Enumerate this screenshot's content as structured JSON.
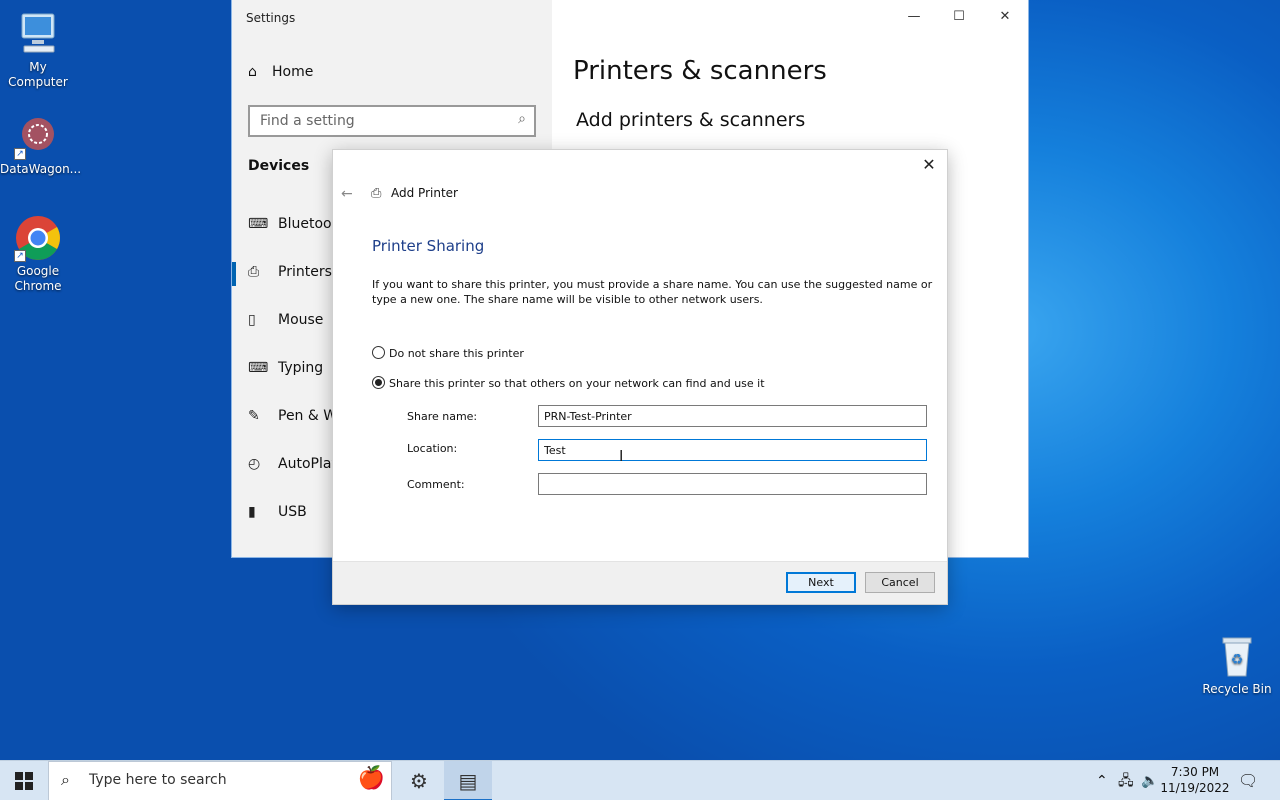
{
  "desktop": {
    "icons": [
      {
        "label": "My Computer",
        "icon": "computer-icon"
      },
      {
        "label": "DataWagon...",
        "icon": "datawagon-icon"
      },
      {
        "label": "Google Chrome",
        "icon": "chrome-icon"
      },
      {
        "label": "Recycle Bin",
        "icon": "recycle-bin-icon"
      }
    ]
  },
  "settings": {
    "title": "Settings",
    "controls": {
      "minimize": "—",
      "maximize": "☐",
      "close": "✕"
    },
    "home": "Home",
    "search_placeholder": "Find a setting",
    "group": "Devices",
    "nav": [
      {
        "label": "Bluetooth",
        "icon": "bluetooth-keyboard-icon"
      },
      {
        "label": "Printers &",
        "icon": "printer-icon",
        "selected": true
      },
      {
        "label": "Mouse",
        "icon": "mouse-icon"
      },
      {
        "label": "Typing",
        "icon": "keyboard-icon"
      },
      {
        "label": "Pen & W",
        "icon": "pen-icon"
      },
      {
        "label": "AutoPlay",
        "icon": "autoplay-icon"
      },
      {
        "label": "USB",
        "icon": "usb-icon"
      }
    ],
    "page_title": "Printers & scanners",
    "section_title": "Add printers & scanners"
  },
  "dialog": {
    "title": "Add Printer",
    "heading": "Printer Sharing",
    "description": "If you want to share this printer, you must provide a share name. You can use the suggested name or type a new one. The share name will be visible to other network users.",
    "options": [
      {
        "label": "Do not share this printer",
        "selected": false
      },
      {
        "label": "Share this printer so that others on your network can find and use it",
        "selected": true
      }
    ],
    "fields": {
      "share_name": {
        "label": "Share name:",
        "value": "PRN-Test-Printer"
      },
      "location": {
        "label": "Location:",
        "value": "Test"
      },
      "comment": {
        "label": "Comment:",
        "value": ""
      }
    },
    "buttons": {
      "next": "Next",
      "cancel": "Cancel"
    }
  },
  "taskbar": {
    "search_placeholder": "Type here to search",
    "time": "7:30 PM",
    "date": "11/19/2022"
  },
  "colors": {
    "accent": "#0078d7",
    "heading": "#1e3f8a",
    "desktop": "#0b60c4"
  }
}
